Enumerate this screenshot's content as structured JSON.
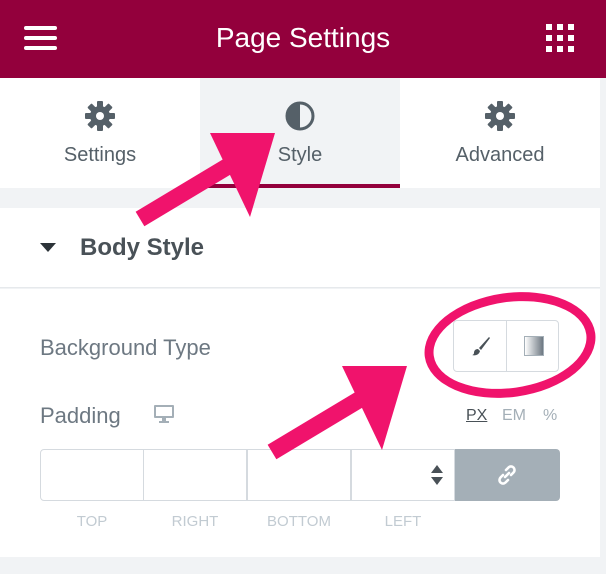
{
  "header": {
    "title": "Page Settings",
    "left_icon": "hamburger-menu-icon",
    "right_icon": "apps-grid-icon"
  },
  "tabs": [
    {
      "label": "Settings",
      "icon": "gear-icon",
      "active": false
    },
    {
      "label": "Style",
      "icon": "half-circle-contrast-icon",
      "active": true
    },
    {
      "label": "Advanced",
      "icon": "gear-icon",
      "active": false
    }
  ],
  "section": {
    "title": "Body Style",
    "expanded": true
  },
  "controls": {
    "background_type": {
      "label": "Background Type",
      "options": [
        "paint-brush-icon",
        "gradient-icon"
      ]
    },
    "padding": {
      "label": "Padding",
      "device_icon": "desktop-monitor-icon",
      "units": [
        "PX",
        "EM",
        "%"
      ],
      "selected_unit": "PX",
      "fields": [
        {
          "label": "TOP",
          "value": ""
        },
        {
          "label": "RIGHT",
          "value": ""
        },
        {
          "label": "BOTTOM",
          "value": ""
        },
        {
          "label": "LEFT",
          "value": ""
        }
      ],
      "link_icon": "chain-link-icon"
    }
  },
  "colors": {
    "header_bg": "#93003c",
    "annotation": "#f0136c",
    "link_button": "#a4afb7"
  }
}
